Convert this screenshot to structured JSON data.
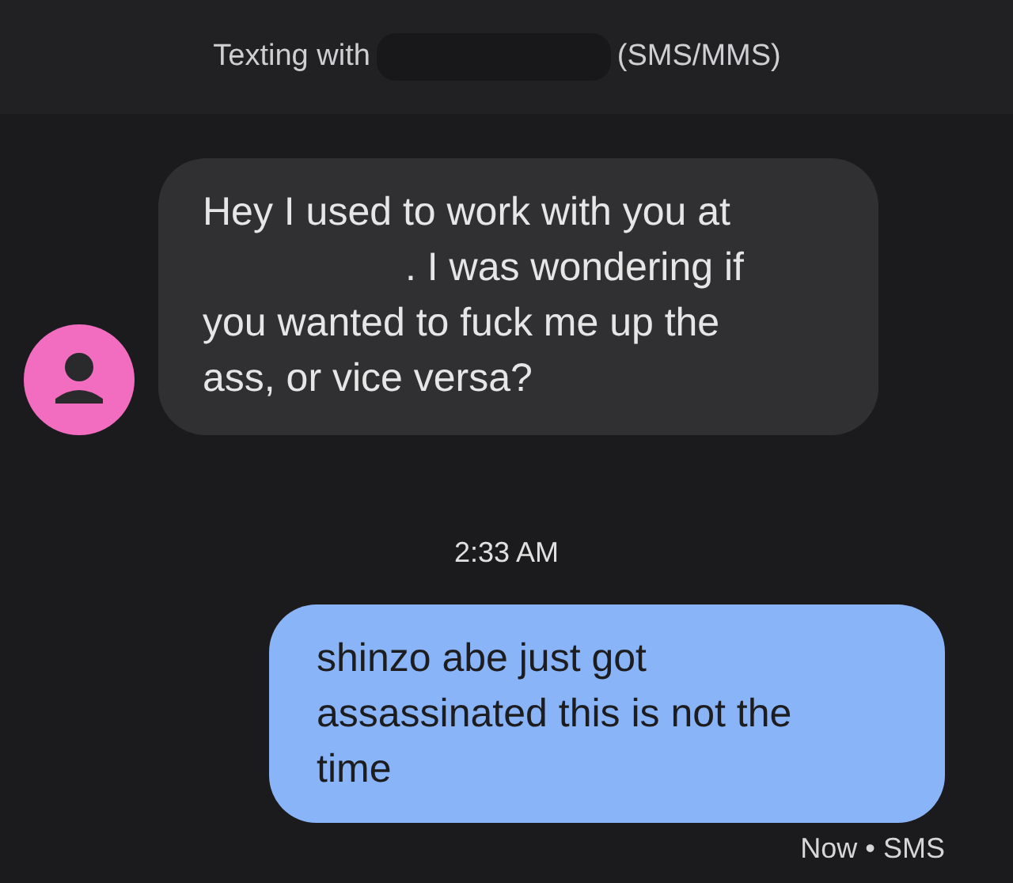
{
  "header": {
    "prefix": "Texting with",
    "suffix": "(SMS/MMS)"
  },
  "messages": [
    {
      "kind": "incoming",
      "lines": [
        {
          "text": "Hey I used to work with you at",
          "after_gap": false
        },
        {
          "text": ". I was wondering if",
          "after_gap": true
        },
        {
          "text": "you wanted to fuck me up the",
          "after_gap": false
        },
        {
          "text": "ass, or vice versa?",
          "after_gap": false
        }
      ]
    },
    {
      "kind": "timestamp",
      "text": "2:33 AM"
    },
    {
      "kind": "outgoing",
      "lines": [
        {
          "text": "shinzo abe just got",
          "after_gap": false
        },
        {
          "text": "assassinated this is not the",
          "after_gap": false
        },
        {
          "text": "time",
          "after_gap": false
        }
      ]
    },
    {
      "kind": "status",
      "text": "Now • SMS"
    }
  ]
}
